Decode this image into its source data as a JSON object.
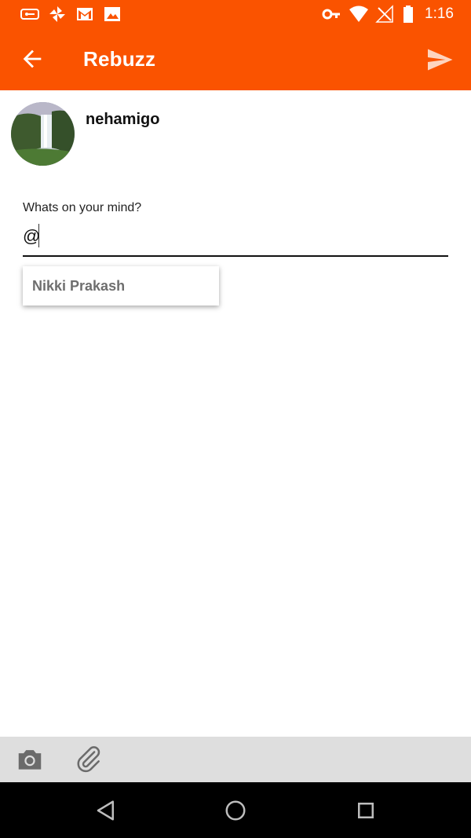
{
  "status_bar": {
    "time": "1:16",
    "icons": [
      "vpn-key-badge-icon",
      "pinwheel-icon",
      "gmail-icon",
      "image-icon",
      "key-icon",
      "wifi-icon",
      "no-signal-icon",
      "battery-icon"
    ]
  },
  "app_bar": {
    "title": "Rebuzz",
    "background": "#fa5300",
    "back_icon": "back-arrow-icon",
    "send_icon": "send-icon"
  },
  "post": {
    "username": "nehamigo",
    "avatar": "waterfall-avatar",
    "label": "Whats on your mind?",
    "input_value": "@"
  },
  "suggestions": [
    {
      "name": "Nikki Prakash"
    }
  ],
  "toolbar": {
    "icons": [
      "camera-icon",
      "attachment-icon"
    ]
  },
  "nav_bar": {
    "icons": [
      "back-triangle-icon",
      "home-circle-icon",
      "recents-square-icon"
    ]
  }
}
